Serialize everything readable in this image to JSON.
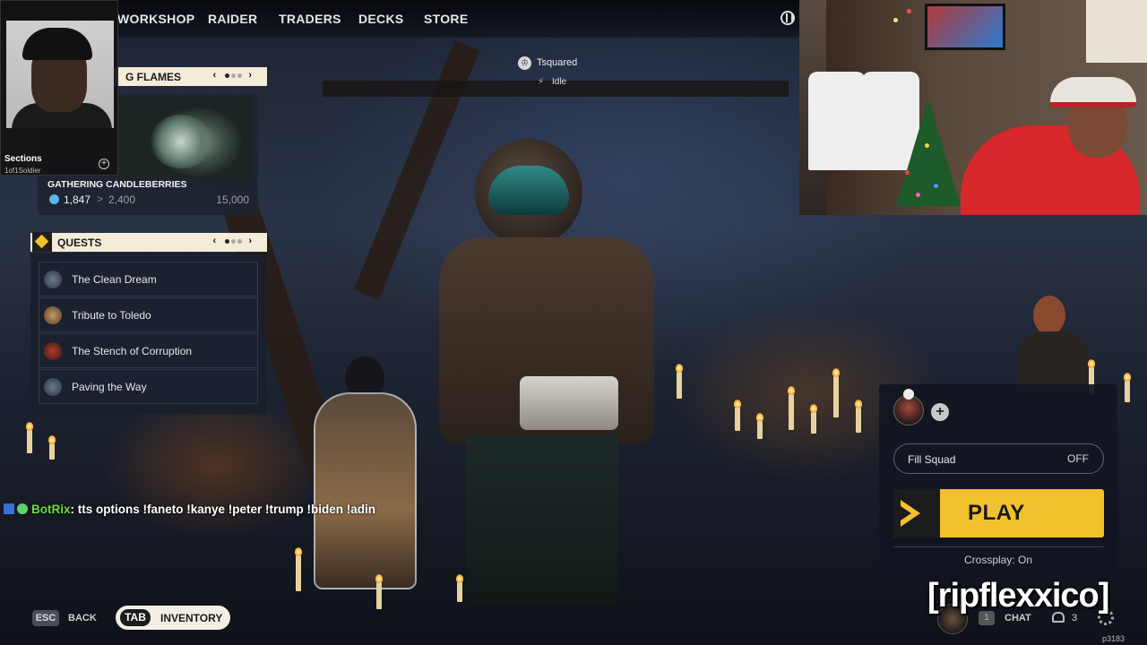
{
  "nav": {
    "items": [
      "WORKSHOP",
      "RAIDER",
      "TRADERS",
      "DECKS",
      "STORE"
    ]
  },
  "player": {
    "name": "Tsquared",
    "status": "Idle"
  },
  "album": {
    "title": "Sections",
    "artist": "1of1Soldier"
  },
  "flames": {
    "header": "G FLAMES",
    "card_title": "GATHERING CANDLEBERRIES",
    "current": "1,847",
    "separator": ">",
    "next": "2,400",
    "max": "15,000"
  },
  "quests": {
    "header": "QUESTS",
    "items": [
      {
        "label": "The Clean Dream"
      },
      {
        "label": "Tribute to Toledo"
      },
      {
        "label": "The Stench of Corruption"
      },
      {
        "label": "Paving the Way"
      }
    ]
  },
  "chat": {
    "user": "BotRix",
    "message": ": tts options !faneto !kanye !peter !trump !biden !adin"
  },
  "bottom_left": {
    "esc_key": "ESC",
    "back_label": "BACK",
    "tab_key": "TAB",
    "inventory_label": "INVENTORY"
  },
  "squad": {
    "add_symbol": "+",
    "fill_label": "Fill Squad",
    "fill_value": "OFF",
    "play_label": "PLAY",
    "crossplay": "Crossplay: On"
  },
  "bottom_right": {
    "watermark": "[ripflexxico]",
    "chat_key": "1",
    "chat_label": "CHAT",
    "friends_count": "3",
    "build": "p3183"
  },
  "colors": {
    "accent_yellow": "#f2c12e",
    "panel_cream": "#f3ecd9",
    "chat_user_green": "#6fdc3f"
  }
}
